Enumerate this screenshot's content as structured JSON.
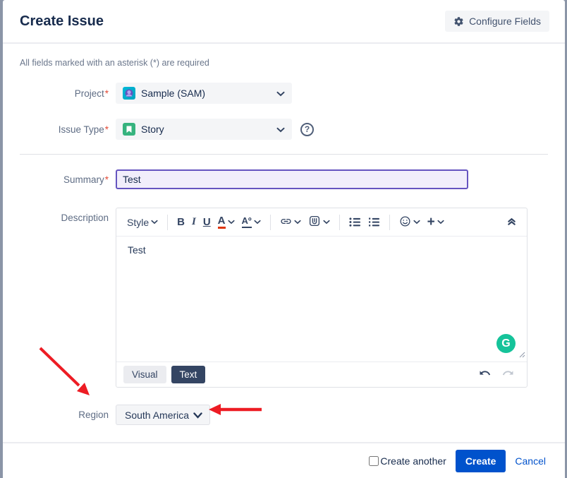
{
  "dialog": {
    "title": "Create Issue",
    "configure_fields_label": "Configure Fields",
    "required_note": "All fields marked with an asterisk (*) are required"
  },
  "fields": {
    "project": {
      "label": "Project",
      "required_mark": "*",
      "value": "Sample (SAM)"
    },
    "issue_type": {
      "label": "Issue Type",
      "required_mark": "*",
      "value": "Story"
    },
    "summary": {
      "label": "Summary",
      "required_mark": "*",
      "value": "Test"
    },
    "description": {
      "label": "Description",
      "value": "Test"
    },
    "region": {
      "label": "Region",
      "value": "South America"
    }
  },
  "editor": {
    "toolbar": {
      "style_label": "Style",
      "bold_glyph": "B",
      "italic_glyph": "I",
      "underline_glyph": "U",
      "text_color_glyph": "A",
      "more_formatting_glyph": "Aº",
      "plus_glyph": "+"
    },
    "tabs": {
      "visual_label": "Visual",
      "text_label": "Text"
    },
    "grammarly_glyph": "G"
  },
  "help_glyph": "?",
  "footer": {
    "create_another_label": "Create another",
    "create_label": "Create",
    "cancel_label": "Cancel"
  },
  "icons": {
    "gear": "gear-icon",
    "chevron_down": "chevron-down-icon",
    "link": "link-icon",
    "attachment": "attachment-icon",
    "bullet_list": "bullet-list-icon",
    "numbered_list": "numbered-list-icon",
    "emoji": "emoji-icon",
    "collapse": "collapse-chevrons-icon",
    "undo": "undo-icon",
    "redo": "redo-icon",
    "story": "story-bookmark-icon",
    "project_avatar": "project-avatar-icon"
  },
  "colors": {
    "primary_blue": "#0052cc",
    "title_navy": "#172b4d",
    "summary_focus_purple": "#6554c0",
    "story_green": "#36b37e",
    "grammarly_green": "#15c39a",
    "annotation_red": "#ed1c24",
    "text_tab_navy": "#344563"
  }
}
